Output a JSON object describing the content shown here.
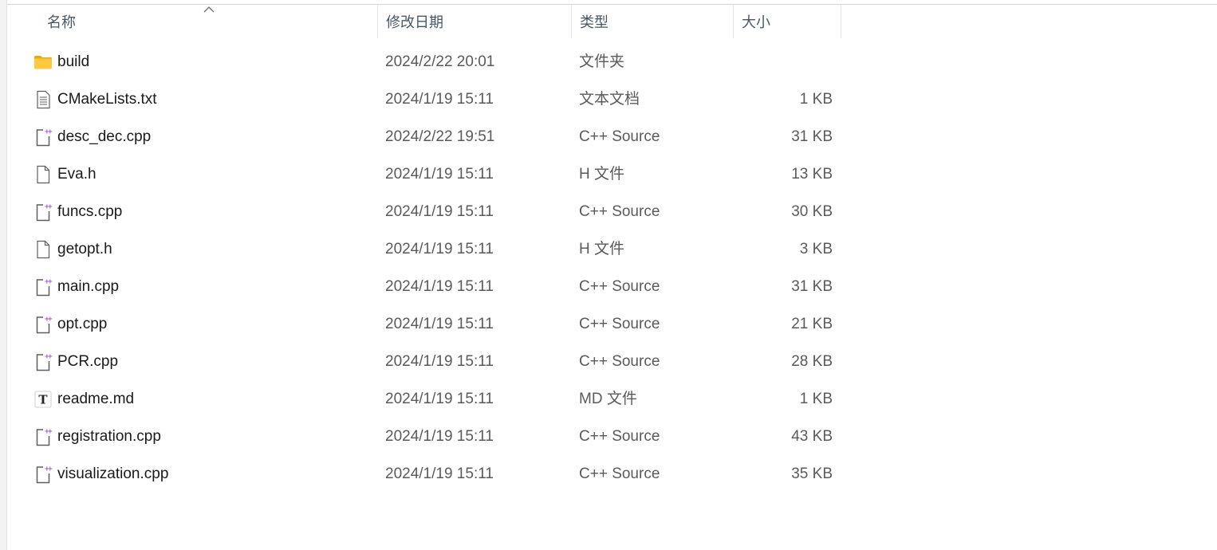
{
  "columns": {
    "name": "名称",
    "date": "修改日期",
    "type": "类型",
    "size": "大小"
  },
  "sort": {
    "column": "name",
    "direction": "ascending",
    "icon": "chevron-up-icon"
  },
  "files": [
    {
      "name": "build",
      "date": "2024/2/22 20:01",
      "type": "文件夹",
      "size": "",
      "icon": "folder-icon"
    },
    {
      "name": "CMakeLists.txt",
      "date": "2024/1/19 15:11",
      "type": "文本文档",
      "size": "1 KB",
      "icon": "text-file-icon"
    },
    {
      "name": "desc_dec.cpp",
      "date": "2024/2/22 19:51",
      "type": "C++ Source",
      "size": "31 KB",
      "icon": "cpp-file-icon"
    },
    {
      "name": "Eva.h",
      "date": "2024/1/19 15:11",
      "type": "H 文件",
      "size": "13 KB",
      "icon": "blank-file-icon"
    },
    {
      "name": "funcs.cpp",
      "date": "2024/1/19 15:11",
      "type": "C++ Source",
      "size": "30 KB",
      "icon": "cpp-file-icon"
    },
    {
      "name": "getopt.h",
      "date": "2024/1/19 15:11",
      "type": "H 文件",
      "size": "3 KB",
      "icon": "blank-file-icon"
    },
    {
      "name": "main.cpp",
      "date": "2024/1/19 15:11",
      "type": "C++ Source",
      "size": "31 KB",
      "icon": "cpp-file-icon"
    },
    {
      "name": "opt.cpp",
      "date": "2024/1/19 15:11",
      "type": "C++ Source",
      "size": "21 KB",
      "icon": "cpp-file-icon"
    },
    {
      "name": "PCR.cpp",
      "date": "2024/1/19 15:11",
      "type": "C++ Source",
      "size": "28 KB",
      "icon": "cpp-file-icon"
    },
    {
      "name": "readme.md",
      "date": "2024/1/19 15:11",
      "type": "MD 文件",
      "size": "1 KB",
      "icon": "markdown-file-icon"
    },
    {
      "name": "registration.cpp",
      "date": "2024/1/19 15:11",
      "type": "C++ Source",
      "size": "43 KB",
      "icon": "cpp-file-icon"
    },
    {
      "name": "visualization.cpp",
      "date": "2024/1/19 15:11",
      "type": "C++ Source",
      "size": "35 KB",
      "icon": "cpp-file-icon"
    }
  ],
  "colors": {
    "folder": "#ffc83d",
    "folder_dark": "#e8a917",
    "cpp_plus": "#9b4fc4",
    "icon_stroke": "#5f5f5f"
  },
  "markdown_glyph": "T"
}
